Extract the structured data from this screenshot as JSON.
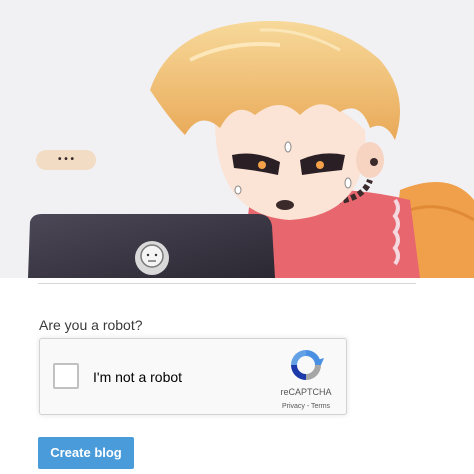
{
  "form": {
    "question": "Are you a robot?",
    "create_button_label": "Create blog"
  },
  "captcha": {
    "checkbox_label": "I'm not a robot",
    "brand": "reCAPTCHA",
    "privacy_link": "Privacy",
    "separator": " - ",
    "terms_link": "Terms",
    "checked": false
  },
  "illustration": {
    "speech_bubble_text": "• • •"
  },
  "colors": {
    "button": "#4a9bd9",
    "captcha_bg": "#f9f9f9",
    "hair": "#f2c46e",
    "sweater": "#e8676f",
    "laptop": "#3d3a47"
  }
}
